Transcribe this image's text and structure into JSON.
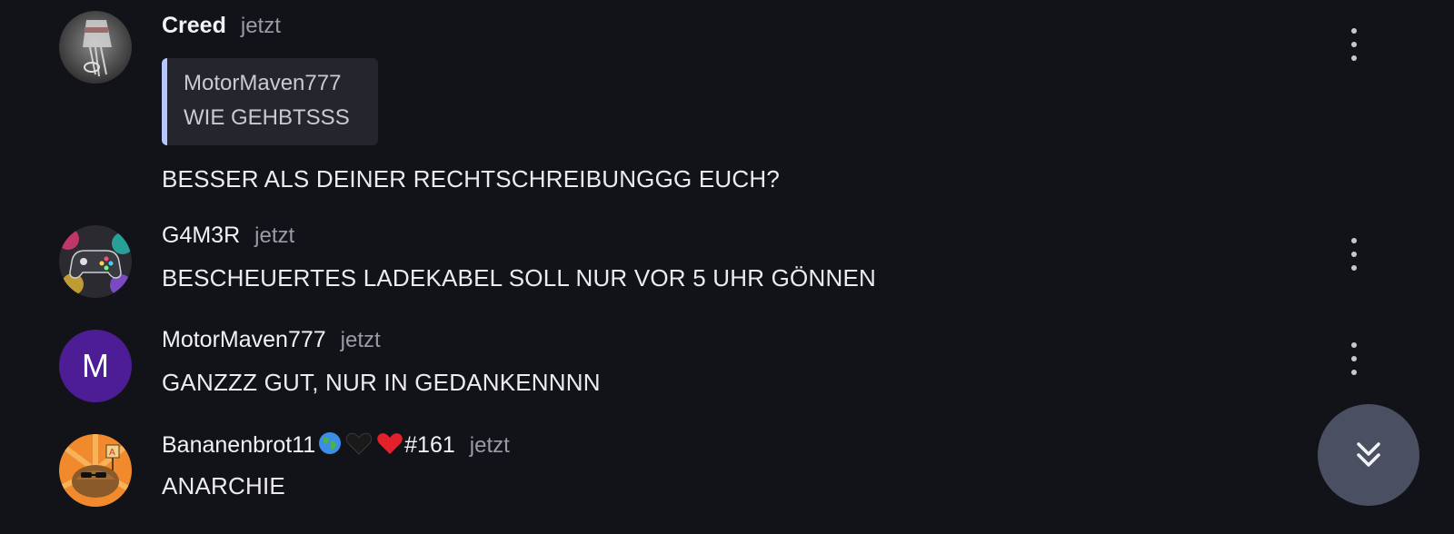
{
  "messages": [
    {
      "author": "Creed",
      "time": "jetzt",
      "avatar_icon": "photo-avatar-icon",
      "quote": {
        "author": "MotorMaven777",
        "text": "WIE GEHBTSSS"
      },
      "text": "BESSER ALS DEINER RECHTSCHREIBUNGGG EUCH?"
    },
    {
      "author": "G4M3R",
      "time": "jetzt",
      "avatar_icon": "gamepad-avatar-icon",
      "text": "BESCHEUERTES LADEKABEL SOLL NUR VOR 5 UHR GÖNNEN"
    },
    {
      "author": "MotorMaven777",
      "time": "jetzt",
      "avatar_letter": "M",
      "avatar_color": "#4c1d95",
      "text": "GANZZZ GUT, NUR IN GEDANKENNNN"
    },
    {
      "author_name": "Bananenbrot11",
      "author_suffix": "#161",
      "author_emojis": [
        "globe-emoji",
        "black-heart-emoji",
        "red-heart-emoji"
      ],
      "time": "jetzt",
      "avatar_icon": "cartoon-avatar-icon",
      "text": "ANARCHIE"
    }
  ],
  "colors": {
    "background": "#121318",
    "quote_bar": "#b7c6ff",
    "scroll_button": "#4a5061"
  },
  "icons": {
    "more": "more-vertical-icon",
    "scroll_down": "double-chevron-down-icon"
  }
}
